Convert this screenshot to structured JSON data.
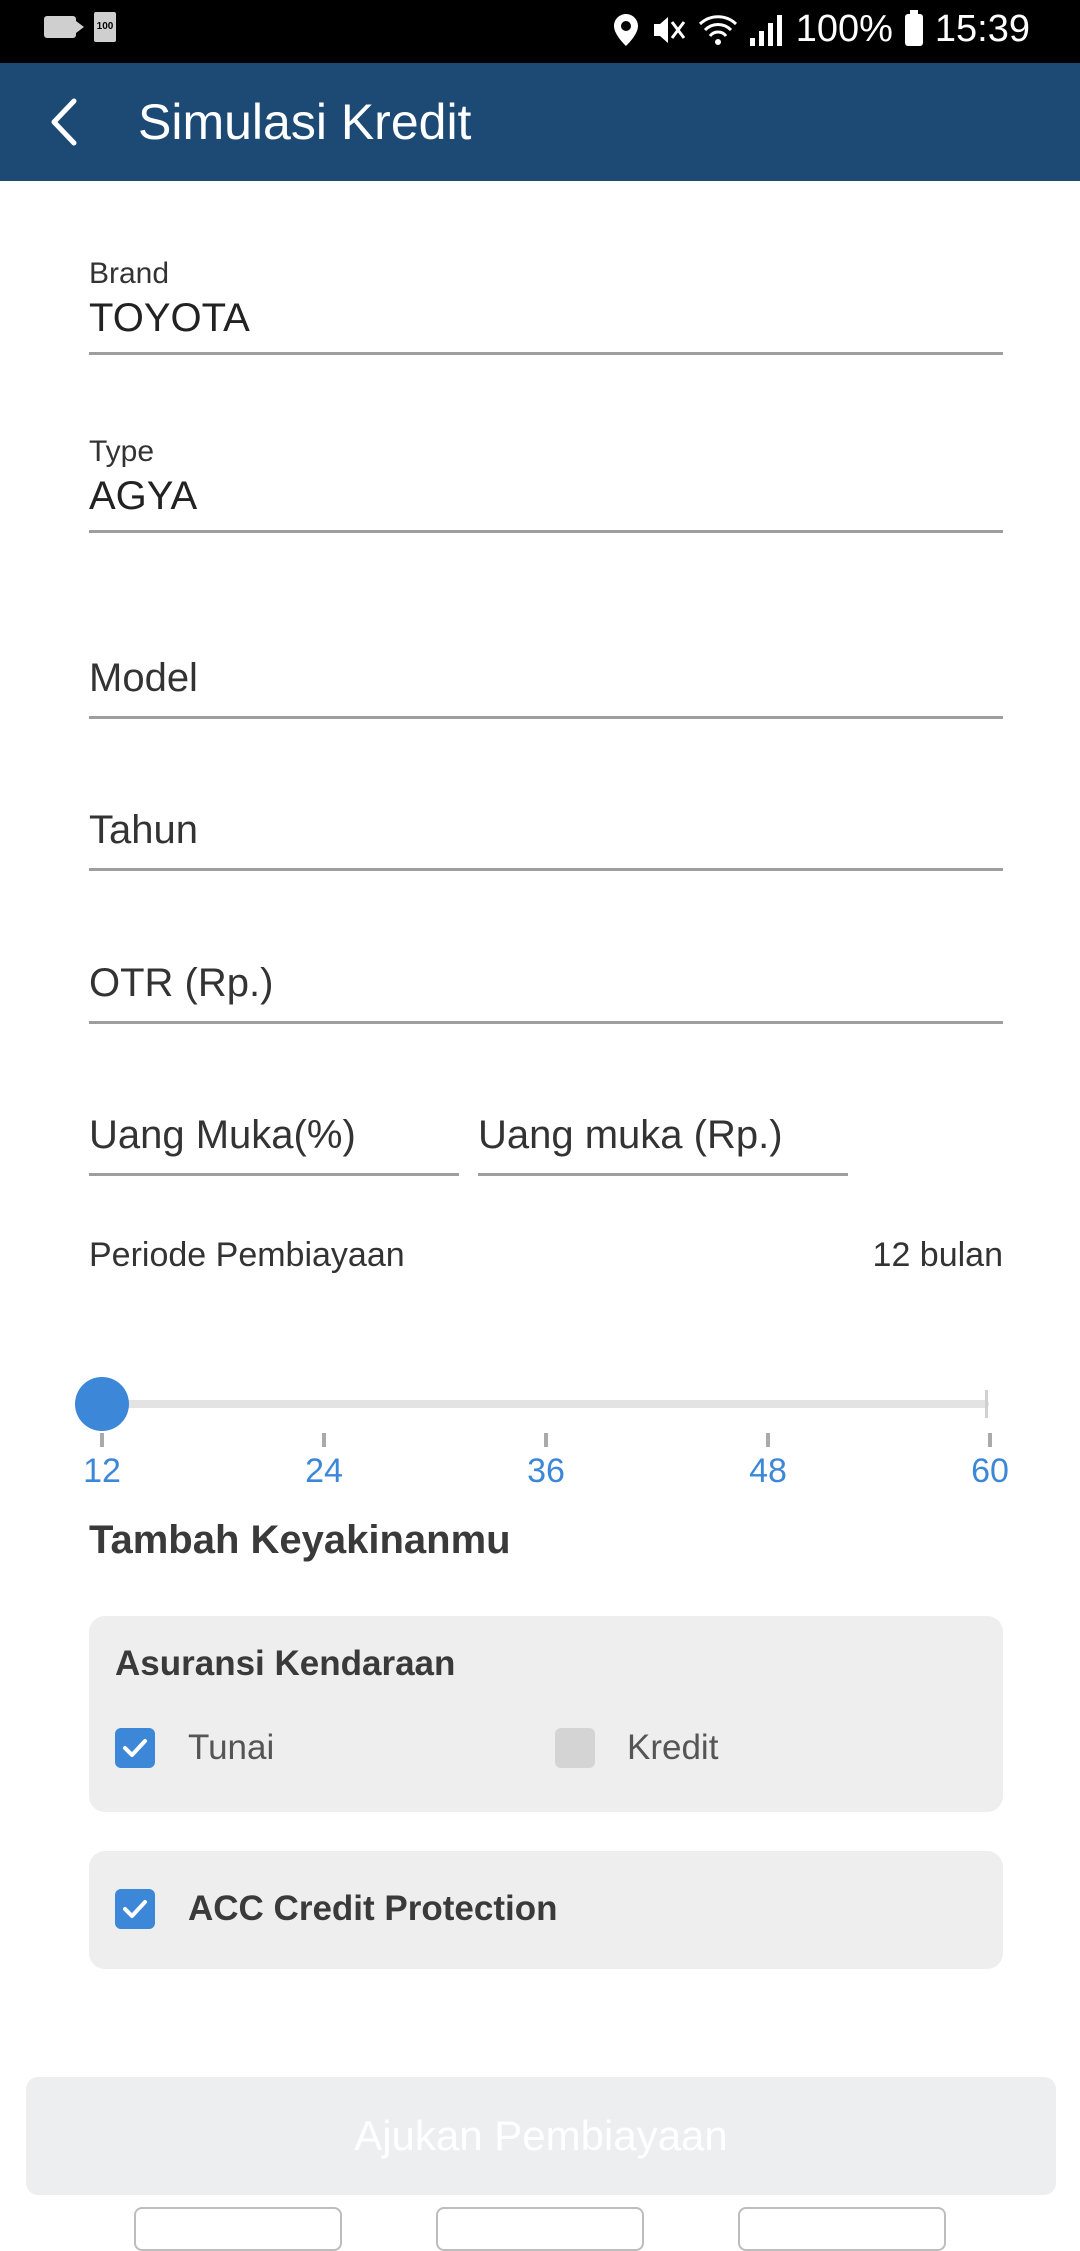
{
  "status_bar": {
    "battery_percent": "100%",
    "time": "15:39",
    "icons": [
      "video-camera-icon",
      "battery-saver-icon",
      "location-icon",
      "mute-icon",
      "wifi-icon",
      "signal-icon",
      "battery-icon"
    ]
  },
  "app_bar": {
    "title": "Simulasi Kredit",
    "back_icon": "back-arrow-icon"
  },
  "form": {
    "brand": {
      "label": "Brand",
      "value": "TOYOTA"
    },
    "type": {
      "label": "Type",
      "value": "AGYA"
    },
    "model": {
      "placeholder": "Model"
    },
    "tahun": {
      "placeholder": "Tahun"
    },
    "otr": {
      "placeholder": "OTR (Rp.)"
    },
    "uang_muka_percent": {
      "placeholder": "Uang Muka(%)"
    },
    "uang_muka_rp": {
      "placeholder": "Uang muka (Rp.)"
    }
  },
  "period": {
    "label": "Periode Pembiayaan",
    "value_text": "12 bulan",
    "selected": 12,
    "ticks": [
      "12",
      "24",
      "36",
      "48",
      "60"
    ]
  },
  "extras": {
    "title": "Tambah Keyakinanmu",
    "insurance": {
      "title": "Asuransi Kendaraan",
      "options": [
        {
          "label": "Tunai",
          "checked": true
        },
        {
          "label": "Kredit",
          "checked": false
        }
      ]
    },
    "protection": {
      "label": "ACC Credit Protection",
      "checked": true
    }
  },
  "submit_button": {
    "label": "Ajukan Pembiayaan"
  },
  "colors": {
    "app_bar": "#1d4a74",
    "accent": "#3d87d8",
    "card_bg": "#eeeeee",
    "button_disabled": "#eceef0"
  }
}
